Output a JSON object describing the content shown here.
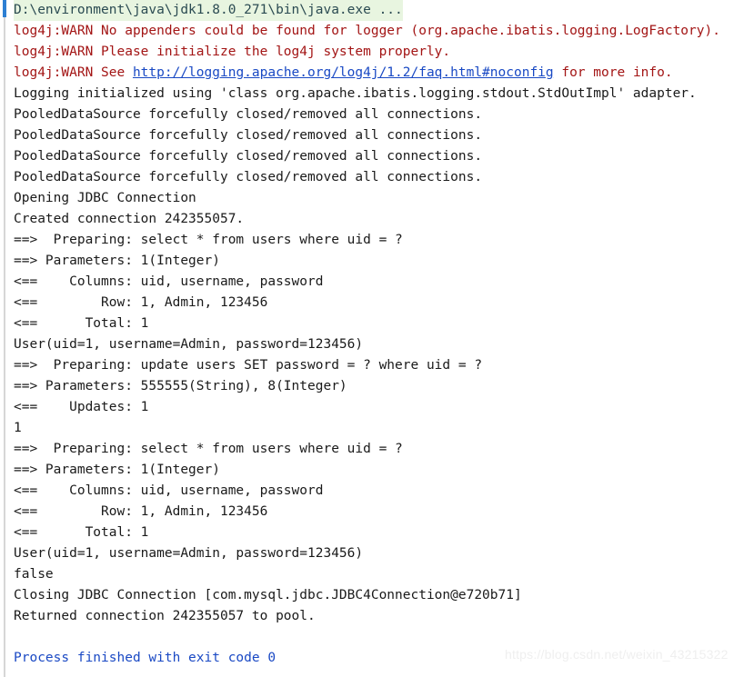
{
  "console": {
    "name": "ide-run-console",
    "colors": {
      "background": "#ffffff",
      "command_text": "#2b4b52",
      "command_highlight": "#e8f5e0",
      "warning_text": "#a31515",
      "plain_text": "#1a1a1a",
      "link_text": "#1949c4",
      "exit_text": "#1a49c4",
      "gutter_line": "#d6d6d6",
      "gutter_marker": "#2d7fd3",
      "watermark": "#efefef"
    },
    "lines": [
      {
        "id": "l01",
        "style": "cmd",
        "text": "D:\\environment\\java\\jdk1.8.0_271\\bin\\java.exe ..."
      },
      {
        "id": "l02",
        "style": "warn",
        "text": "log4j:WARN No appenders could be found for logger (org.apache.ibatis.logging.LogFactory)."
      },
      {
        "id": "l03",
        "style": "warn",
        "text": "log4j:WARN Please initialize the log4j system properly."
      },
      {
        "id": "l04",
        "style": "warn-link",
        "prefix": "log4j:WARN See ",
        "link": "http://logging.apache.org/log4j/1.2/faq.html#noconfig",
        "suffix": " for more info."
      },
      {
        "id": "l05",
        "style": "plain",
        "text": "Logging initialized using 'class org.apache.ibatis.logging.stdout.StdOutImpl' adapter."
      },
      {
        "id": "l06",
        "style": "plain",
        "text": "PooledDataSource forcefully closed/removed all connections."
      },
      {
        "id": "l07",
        "style": "plain",
        "text": "PooledDataSource forcefully closed/removed all connections."
      },
      {
        "id": "l08",
        "style": "plain",
        "text": "PooledDataSource forcefully closed/removed all connections."
      },
      {
        "id": "l09",
        "style": "plain",
        "text": "PooledDataSource forcefully closed/removed all connections."
      },
      {
        "id": "l10",
        "style": "plain",
        "text": "Opening JDBC Connection"
      },
      {
        "id": "l11",
        "style": "plain",
        "text": "Created connection 242355057."
      },
      {
        "id": "l12",
        "style": "plain",
        "text": "==>  Preparing: select * from users where uid = ?"
      },
      {
        "id": "l13",
        "style": "plain",
        "text": "==> Parameters: 1(Integer)"
      },
      {
        "id": "l14",
        "style": "plain",
        "text": "<==    Columns: uid, username, password"
      },
      {
        "id": "l15",
        "style": "plain",
        "text": "<==        Row: 1, Admin, 123456"
      },
      {
        "id": "l16",
        "style": "plain",
        "text": "<==      Total: 1"
      },
      {
        "id": "l17",
        "style": "plain",
        "text": "User(uid=1, username=Admin, password=123456)"
      },
      {
        "id": "l18",
        "style": "plain",
        "text": "==>  Preparing: update users SET password = ? where uid = ?"
      },
      {
        "id": "l19",
        "style": "plain",
        "text": "==> Parameters: 555555(String), 8(Integer)"
      },
      {
        "id": "l20",
        "style": "plain",
        "text": "<==    Updates: 1"
      },
      {
        "id": "l21",
        "style": "plain",
        "text": "1"
      },
      {
        "id": "l22",
        "style": "plain",
        "text": "==>  Preparing: select * from users where uid = ?"
      },
      {
        "id": "l23",
        "style": "plain",
        "text": "==> Parameters: 1(Integer)"
      },
      {
        "id": "l24",
        "style": "plain",
        "text": "<==    Columns: uid, username, password"
      },
      {
        "id": "l25",
        "style": "plain",
        "text": "<==        Row: 1, Admin, 123456"
      },
      {
        "id": "l26",
        "style": "plain",
        "text": "<==      Total: 1"
      },
      {
        "id": "l27",
        "style": "plain",
        "text": "User(uid=1, username=Admin, password=123456)"
      },
      {
        "id": "l28",
        "style": "plain",
        "text": "false"
      },
      {
        "id": "l29",
        "style": "plain",
        "text": "Closing JDBC Connection [com.mysql.jdbc.JDBC4Connection@e720b71]"
      },
      {
        "id": "l30",
        "style": "plain",
        "text": "Returned connection 242355057 to pool."
      },
      {
        "id": "l31",
        "style": "blank",
        "text": ""
      },
      {
        "id": "l32",
        "style": "exit",
        "text": "Process finished with exit code 0"
      }
    ]
  },
  "watermark": {
    "text": "https://blog.csdn.net/weixin_43215322"
  }
}
